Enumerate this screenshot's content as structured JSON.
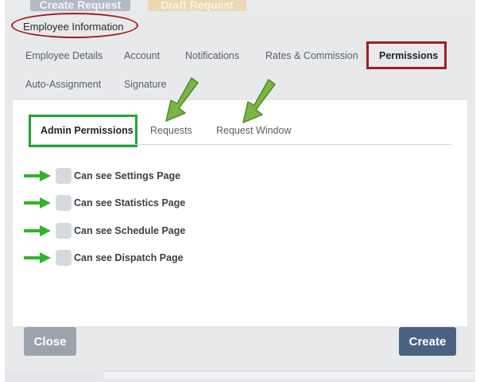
{
  "background": {
    "button_1": "Create Request",
    "button_2": "Draft Request"
  },
  "modal": {
    "title": "Employee Information",
    "nav_tabs": [
      {
        "label": "Employee Details"
      },
      {
        "label": "Account"
      },
      {
        "label": "Notifications"
      },
      {
        "label": "Rates & Commission"
      },
      {
        "label": "Permissions"
      },
      {
        "label": "Auto-Assignment"
      },
      {
        "label": "Signature"
      }
    ],
    "sub_tabs": [
      {
        "label": "Admin Permissions"
      },
      {
        "label": "Requests"
      },
      {
        "label": "Request Window"
      }
    ],
    "checkboxes": [
      {
        "label": "Can see Settings Page",
        "checked": false
      },
      {
        "label": "Can see Statistics Page",
        "checked": false
      },
      {
        "label": "Can see Schedule Page",
        "checked": false
      },
      {
        "label": "Can see Dispatch Page",
        "checked": false
      }
    ],
    "close_label": "Close",
    "create_label": "Create"
  },
  "colors": {
    "highlight_red": "#a31f1f",
    "highlight_green": "#22a630",
    "arrow_green": "#2fb52a",
    "create_button": "#4c6283",
    "close_button": "#9ba3ad"
  }
}
